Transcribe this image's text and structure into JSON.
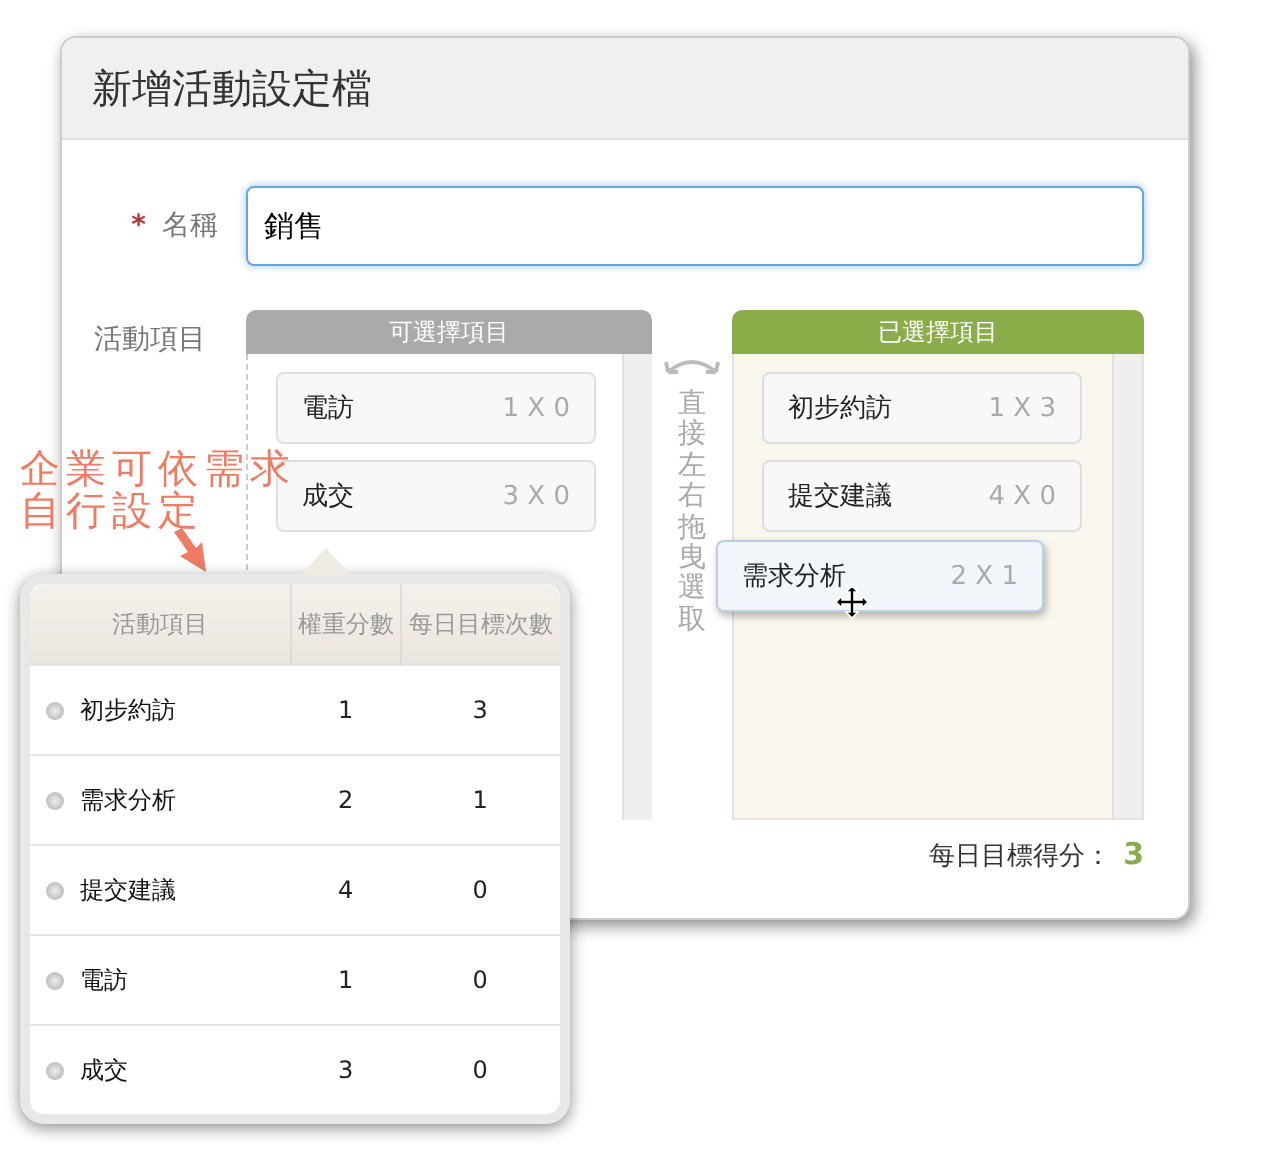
{
  "dialog": {
    "title": "新增活動設定檔"
  },
  "name_field": {
    "required_mark": "*",
    "label": "名稱",
    "value": "銷售"
  },
  "activities": {
    "label": "活動項目",
    "available": {
      "title": "可選擇項目",
      "items": [
        {
          "name": "電訪",
          "score": "1 X 0"
        },
        {
          "name": "成交",
          "score": "3 X 0"
        }
      ]
    },
    "hint": "直接左右拖曳選取",
    "selected": {
      "title": "已選擇項目",
      "items": [
        {
          "name": "初步約訪",
          "score": "1 X 3"
        },
        {
          "name": "提交建議",
          "score": "4 X 0"
        }
      ]
    },
    "dragging_item": {
      "name": "需求分析",
      "score": "2 X 1"
    }
  },
  "daily_score": {
    "label": "每日目標得分：",
    "value": "3"
  },
  "annotation": [
    "企業可依需求",
    "自行設定"
  ],
  "weights_table": {
    "columns": [
      "活動項目",
      "權重分數",
      "每日目標次數"
    ],
    "rows": [
      {
        "name": "初步約訪",
        "weight": "1",
        "target": "3"
      },
      {
        "name": "需求分析",
        "weight": "2",
        "target": "1"
      },
      {
        "name": "提交建議",
        "weight": "4",
        "target": "0"
      },
      {
        "name": "電訪",
        "weight": "1",
        "target": "0"
      },
      {
        "name": "成交",
        "weight": "3",
        "target": "0"
      }
    ]
  }
}
